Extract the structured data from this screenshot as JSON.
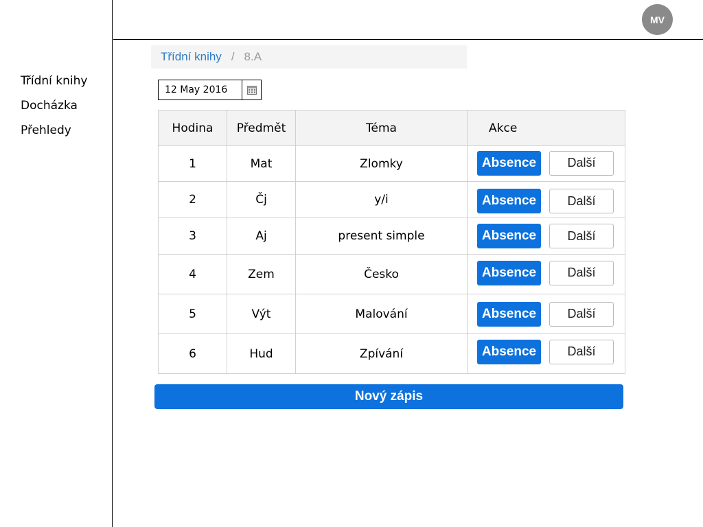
{
  "sidebar": {
    "items": [
      {
        "label": "Třídní knihy"
      },
      {
        "label": "Docházka"
      },
      {
        "label": "Přehledy"
      }
    ]
  },
  "header": {
    "avatar_initials": "MV"
  },
  "breadcrumb": {
    "parent": "Třídní knihy",
    "separator": "/",
    "current": "8.A"
  },
  "date_picker": {
    "value": "12 May 2016",
    "icon": "calendar-icon"
  },
  "table": {
    "headers": [
      "Hodina",
      "Předmět",
      "Téma",
      "Akce"
    ],
    "absence_label": "Absence",
    "more_label": "Další",
    "rows": [
      {
        "hodina": "1",
        "predmet": "Mat",
        "tema": "Zlomky"
      },
      {
        "hodina": "2",
        "predmet": "Čj",
        "tema": "y/i"
      },
      {
        "hodina": "3",
        "predmet": "Aj",
        "tema": "present simple"
      },
      {
        "hodina": "4",
        "predmet": "Zem",
        "tema": "Česko"
      },
      {
        "hodina": "5",
        "predmet": "Výt",
        "tema": "Malování"
      },
      {
        "hodina": "6",
        "predmet": "Hud",
        "tema": "Zpívání"
      }
    ]
  },
  "actions": {
    "new_entry_label": "Nový zápis"
  },
  "colors": {
    "primary": "#0d72dd",
    "link": "#2f7bc4",
    "avatar": "#8a8a8a",
    "header_bg": "#f3f3f3"
  }
}
